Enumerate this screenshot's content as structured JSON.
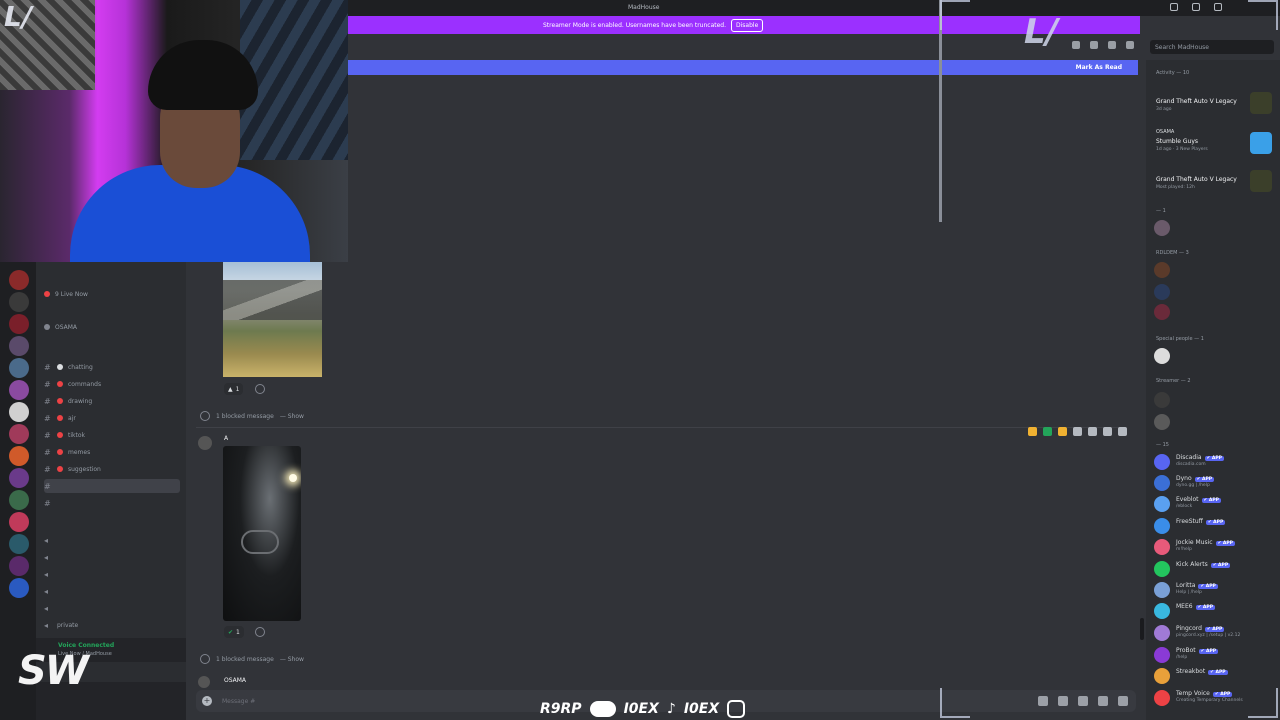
{
  "window": {
    "title": "MadHouse"
  },
  "streamer_bar": {
    "text": "Streamer Mode is enabled. Usernames have been truncated.",
    "disable_label": "Disable"
  },
  "unread_bar": {
    "mark_read_label": "Mark As Read"
  },
  "search": {
    "placeholder": "Search MadHouse"
  },
  "sidebar": {
    "top_rows": [
      {
        "label": "9 Live Now"
      },
      {
        "label": "OSAMA"
      }
    ],
    "category_1": "",
    "channels": [
      {
        "label": "chatting",
        "color": "#dbdee1"
      },
      {
        "label": "commands",
        "color": "#ed4245"
      },
      {
        "label": "drawing",
        "color": "#ed4245"
      },
      {
        "label": "ajr",
        "color": "#ed4245"
      },
      {
        "label": "tiktok",
        "color": "#ed4245"
      },
      {
        "label": "memes",
        "color": "#ed4245"
      },
      {
        "label": "suggestion",
        "color": "#ed4245"
      },
      {
        "label": "",
        "color": "#ed4245",
        "selected": true
      },
      {
        "label": "",
        "color": "#ed4245"
      }
    ],
    "voice_channels": [
      {
        "label": ""
      },
      {
        "label": ""
      },
      {
        "label": ""
      },
      {
        "label": ""
      },
      {
        "label": ""
      },
      {
        "label": "private"
      }
    ],
    "voice": {
      "status": "Voice Connected",
      "server": "Live Now / MadHouse"
    }
  },
  "chat": {
    "reaction_1_count": "1",
    "blocked_1": "1 blocked message",
    "show_label": "— Show",
    "message_author": "A",
    "message_tag": "",
    "reaction_2_count": "1",
    "blocked_2": "1 blocked message",
    "last_author": "OSAMA",
    "last_tag": "",
    "composer_placeholder": "Message #"
  },
  "members": {
    "activity_header": "Activity — 10",
    "activity": [
      {
        "user": "",
        "game": "Grand Theft Auto V Legacy",
        "sub": "3d ago",
        "color": "#3b3f2a"
      },
      {
        "user": "OSAMA",
        "game": "Stumble Guys",
        "sub": "1d ago · 3 New Players",
        "color": "#3aa0e8"
      },
      {
        "user": "",
        "game": "Grand Theft Auto V Legacy",
        "sub": "Most played: 12h",
        "color": "#3b3f2a"
      }
    ],
    "groups": [
      {
        "label": "— 1"
      },
      {
        "label": "RDLDEM — 3"
      },
      {
        "label": "Special people — 1"
      },
      {
        "label": "Streamer — 2"
      },
      {
        "label": "— 15"
      }
    ],
    "apps": [
      {
        "name": "Discadia",
        "sub": "discadia.com",
        "color": "#5865f2"
      },
      {
        "name": "Dyno",
        "sub": "dyno.gg | /help",
        "color": "#3b6fd6"
      },
      {
        "name": "Eveblot",
        "sub": "/eblock",
        "color": "#5aa0f0"
      },
      {
        "name": "FreeStuff",
        "sub": "",
        "color": "#3a8de8"
      },
      {
        "name": "Jockie Music",
        "sub": "m!help",
        "color": "#e85a7a"
      },
      {
        "name": "Kick Alerts",
        "sub": "",
        "color": "#23c55e"
      },
      {
        "name": "Loritta",
        "sub": "Help | /help",
        "color": "#7aa0d6"
      },
      {
        "name": "MEE6",
        "sub": "",
        "color": "#39b8e0"
      },
      {
        "name": "Pingcord",
        "sub": "pingcord.xyz | /setup | v2.12",
        "color": "#a07ad6"
      },
      {
        "name": "ProBot",
        "sub": "/help",
        "color": "#8a3ad6"
      },
      {
        "name": "Streakbot",
        "sub": "",
        "color": "#e8a03a"
      },
      {
        "name": "Temp Voice",
        "sub": "Creating Temporary Channels",
        "color": "#ed4245"
      }
    ]
  },
  "overlay": {
    "channel_logo": "SW",
    "handles": [
      "R9RP",
      "I0EX",
      "I0EX"
    ],
    "corner_mark": "L/"
  },
  "colors": {
    "accent": "#5865f2",
    "streamer": "#9b30ff",
    "bg": "#313338",
    "sidebar": "#2b2d31"
  }
}
